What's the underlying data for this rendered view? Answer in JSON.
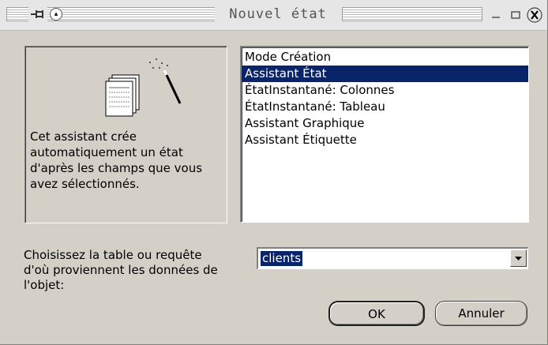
{
  "window": {
    "title": "Nouvel état"
  },
  "preview": {
    "icon": "report-wizard-icon",
    "description": "Cet assistant crée automatiquement un état d'après les champs que vous avez sélectionnés."
  },
  "list": {
    "items": [
      {
        "label": "Mode Création",
        "selected": false
      },
      {
        "label": "Assistant État",
        "selected": true
      },
      {
        "label": "ÉtatInstantané:  Colonnes",
        "selected": false
      },
      {
        "label": "ÉtatInstantané:  Tableau",
        "selected": false
      },
      {
        "label": "Assistant Graphique",
        "selected": false
      },
      {
        "label": "Assistant Étiquette",
        "selected": false
      }
    ]
  },
  "source": {
    "label": "Choisissez la table ou requête d'où proviennent les données de l'objet:",
    "value": "clients"
  },
  "buttons": {
    "ok": "OK",
    "cancel": "Annuler"
  },
  "colors": {
    "face": "#d4d0c8",
    "selection": "#0a246a"
  }
}
